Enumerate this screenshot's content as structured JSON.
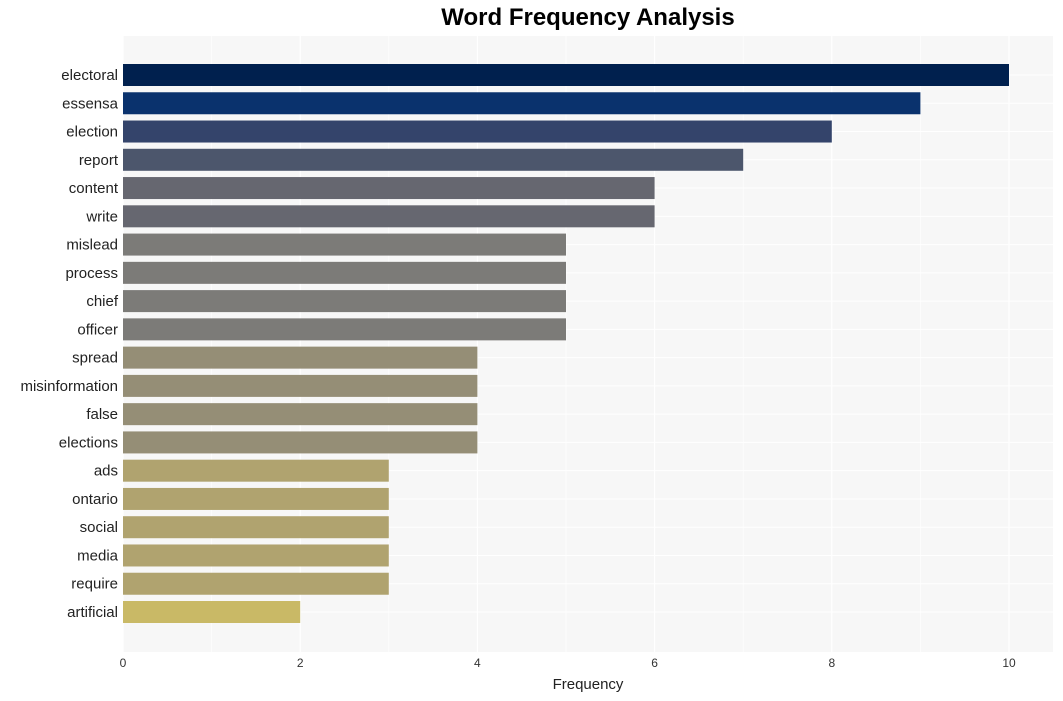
{
  "chart_data": {
    "type": "bar",
    "orientation": "horizontal",
    "title": "Word Frequency Analysis",
    "xlabel": "Frequency",
    "ylabel": "",
    "xlim": [
      0,
      10.5
    ],
    "xticks": [
      0,
      2,
      4,
      6,
      8,
      10
    ],
    "grid": true,
    "legend": "none",
    "categories": [
      "electoral",
      "essensa",
      "election",
      "report",
      "content",
      "write",
      "mislead",
      "process",
      "chief",
      "officer",
      "spread",
      "misinformation",
      "false",
      "elections",
      "ads",
      "ontario",
      "social",
      "media",
      "require",
      "artificial"
    ],
    "values": [
      10,
      9,
      8,
      7,
      6,
      6,
      5,
      5,
      5,
      5,
      4,
      4,
      4,
      4,
      3,
      3,
      3,
      3,
      3,
      2
    ],
    "colors": [
      "#00204e",
      "#0a326d",
      "#34446b",
      "#4c566c",
      "#666770",
      "#666770",
      "#7c7b78",
      "#7c7b78",
      "#7c7b78",
      "#7c7b78",
      "#958e76",
      "#958e76",
      "#958e76",
      "#958e76",
      "#b0a36f",
      "#b0a36f",
      "#b0a36f",
      "#b0a36f",
      "#b0a36f",
      "#c9b966"
    ]
  },
  "style": {
    "plot_background": "#f7f7f7",
    "grid_color": "#ffffff"
  }
}
